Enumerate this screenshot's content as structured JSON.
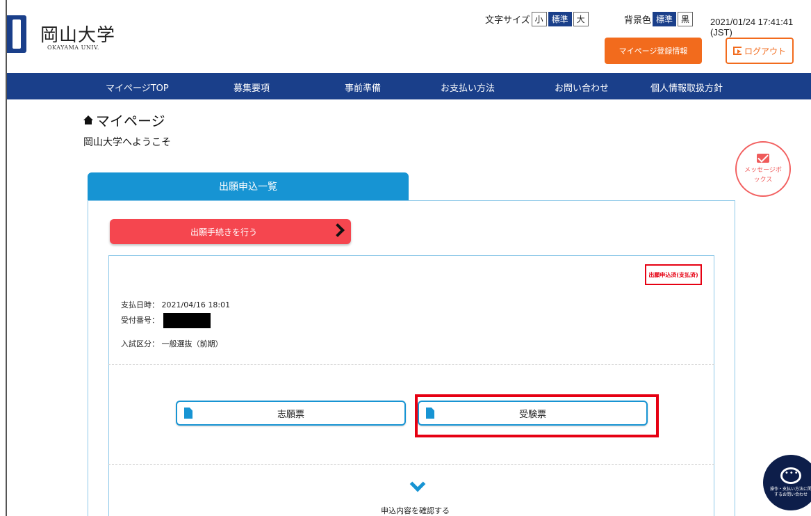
{
  "header": {
    "logo_text": "岡山大学",
    "logo_sub": "OKAYAMA UNIV.",
    "font_size_label": "文字サイズ",
    "font_size_options": [
      "小",
      "標準",
      "大"
    ],
    "bg_color_label": "背景色",
    "bg_color_options": [
      "標準",
      "黒"
    ],
    "datetime": "2021/01/24 17:41:41 (JST)",
    "mypage_info_label": "マイページ登録情報",
    "logout_label": "ログアウト"
  },
  "nav": {
    "items": [
      "マイページTOP",
      "募集要項",
      "事前準備",
      "お支払い方法",
      "お問い合わせ",
      "個人情報取扱方針"
    ]
  },
  "page": {
    "title": "マイページ",
    "welcome": "岡山大学へようこそ"
  },
  "message_box": {
    "label": "メッセージボックス"
  },
  "tab": {
    "label": "出願申込一覧"
  },
  "apply_button": {
    "label": "出願手続きを行う"
  },
  "application": {
    "status": "出願申込済(支払済)",
    "payment_label": "支払日時：",
    "payment_value": "2021/04/16 18:01",
    "receipt_label": "受付番号：",
    "exam_type_label": "入試区分：",
    "exam_type_value": "一般選抜（前期）",
    "application_form_label": "志願票",
    "admission_ticket_label": "受験票",
    "confirm_label": "申込内容を確認する"
  },
  "chat": {
    "label": "操作・支払い方法に関するお問い合わせ"
  },
  "colors": {
    "navy": "#1a3f8a",
    "orange": "#f26b1d",
    "blue": "#1794d3",
    "red": "#f5464f",
    "highlight": "#e60012"
  }
}
